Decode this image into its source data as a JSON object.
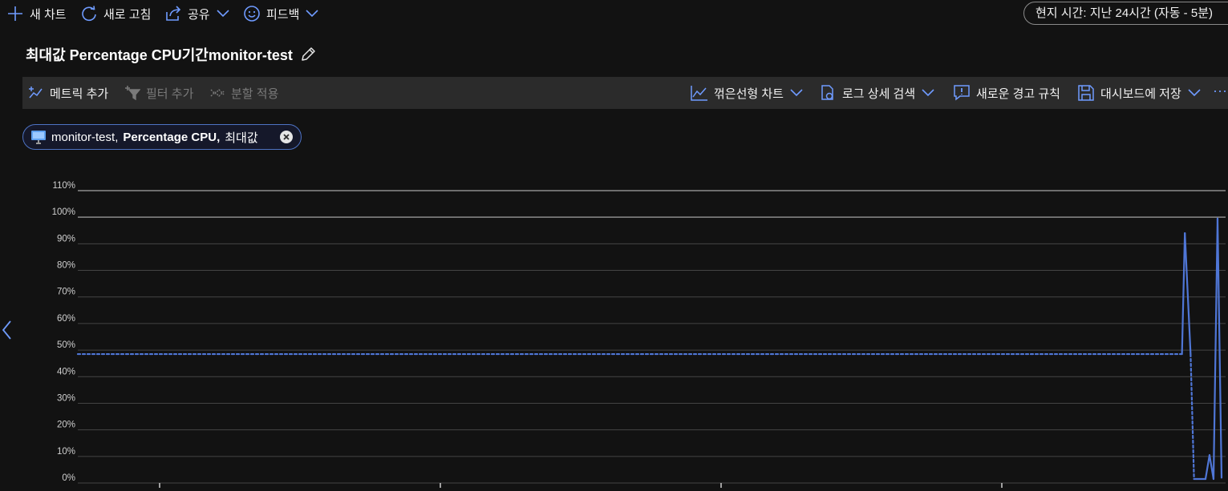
{
  "top_bar": {
    "new_chart": "새 차트",
    "refresh": "새로 고침",
    "share": "공유",
    "feedback": "피드백",
    "time_range": "현지 시간: 지난 24시간 (자동 - 5분)"
  },
  "chart_title": "최대값 Percentage CPU기간monitor-test",
  "toolbar": {
    "add_metric": "메트릭 추가",
    "add_filter": "필터 추가",
    "apply_split": "분할 적용",
    "line_chart": "꺾은선형 차트",
    "log_search": "로그 상세 검색",
    "new_alert_rule": "새로운 경고 규칙",
    "save_dashboard": "대시보드에 저장",
    "more": "···"
  },
  "metric_pill": {
    "resource": "monitor-test,",
    "metric": "Percentage CPU,",
    "aggregation": "최대값"
  },
  "colors": {
    "accent": "#4e73c4",
    "line": "#4f76d6",
    "background": "#121212",
    "toolbar": "#2b2b2b"
  },
  "chart_data": {
    "type": "line",
    "title": "",
    "xlabel": "",
    "ylabel": "",
    "ylim": [
      0,
      110
    ],
    "y_ticks": [
      "110%",
      "100%",
      "90%",
      "80%",
      "70%",
      "60%",
      "50%",
      "40%",
      "30%",
      "20%",
      "10%",
      "0%"
    ],
    "grid": true,
    "x_range": [
      0,
      1000
    ],
    "series": [
      {
        "values": [
          [
            0,
            48.5
          ],
          [
            962,
            48.5
          ],
          [
            964.5,
            94
          ],
          [
            969.5,
            48.5
          ],
          [
            972.5,
            1.5
          ],
          [
            982.5,
            1.5
          ],
          [
            986,
            10.5
          ],
          [
            989.5,
            1.5
          ],
          [
            993,
            99.5
          ],
          [
            996.5,
            2
          ]
        ],
        "dashed_segments": [
          [
            0,
            1
          ],
          [
            3,
            4
          ]
        ]
      }
    ]
  }
}
